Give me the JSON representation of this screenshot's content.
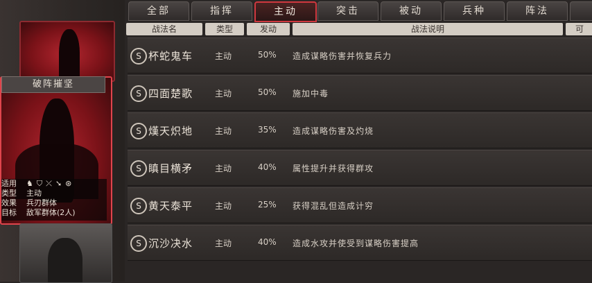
{
  "tabs": [
    {
      "label": "全部"
    },
    {
      "label": "指挥"
    },
    {
      "label": "主动"
    },
    {
      "label": "突击"
    },
    {
      "label": "被动"
    },
    {
      "label": "兵种"
    },
    {
      "label": "阵法"
    }
  ],
  "active_tab": "主动",
  "columns": [
    "战法名",
    "类型",
    "发动",
    "战法说明",
    "可"
  ],
  "card": {
    "title": "破阵摧坚",
    "info": [
      {
        "key": "适用",
        "value": ""
      },
      {
        "key": "类型",
        "value": "主动"
      },
      {
        "key": "效果",
        "value": "兵刃群体"
      },
      {
        "key": "目标",
        "value": "敌军群体(2人)"
      }
    ],
    "unit_icons": [
      "cavalry-icon",
      "shield-icon",
      "bow-icon",
      "spear-icon",
      "instrument-icon"
    ]
  },
  "rows": [
    {
      "badge": "S",
      "name": "杯蛇鬼车",
      "type": "主动",
      "rate": "50%",
      "desc": "造成谋略伤害并恢复兵力"
    },
    {
      "badge": "S",
      "name": "四面楚歌",
      "type": "主动",
      "rate": "50%",
      "desc": "施加中毒"
    },
    {
      "badge": "S",
      "name": "熯天炽地",
      "type": "主动",
      "rate": "35%",
      "desc": "造成谋略伤害及灼烧"
    },
    {
      "badge": "S",
      "name": "瞋目横矛",
      "type": "主动",
      "rate": "40%",
      "desc": "属性提升并获得群攻"
    },
    {
      "badge": "S",
      "name": "黄天泰平",
      "type": "主动",
      "rate": "25%",
      "desc": "获得混乱但造成计穷"
    },
    {
      "badge": "S",
      "name": "沉沙决水",
      "type": "主动",
      "rate": "40%",
      "desc": "造成水攻并使受到谋略伤害提高"
    }
  ],
  "colors": {
    "accent": "#d0383f",
    "header_bg": "#d4cdc4"
  }
}
